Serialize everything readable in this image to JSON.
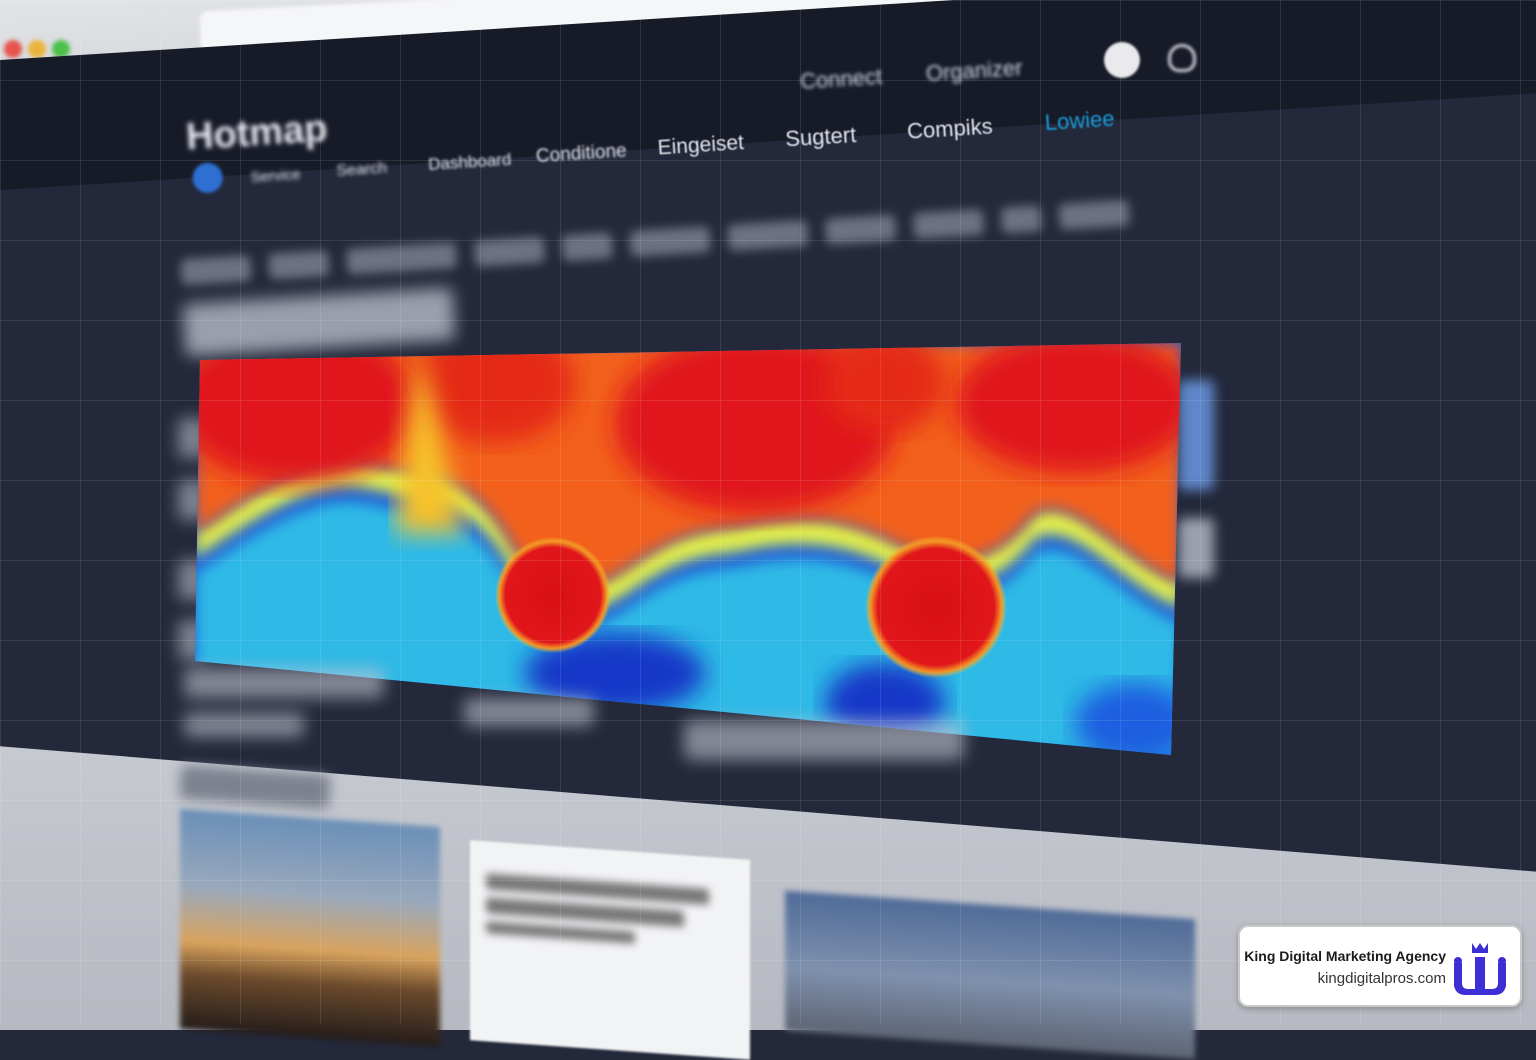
{
  "browser": {
    "tab_title": "",
    "address": ""
  },
  "app": {
    "logo": "Hotmap",
    "header_links": [
      "Connect",
      "Organizer"
    ],
    "nav": [
      {
        "label": "Service"
      },
      {
        "label": "Search"
      },
      {
        "label": "Dashboard"
      },
      {
        "label": "Conditione"
      },
      {
        "label": "Eingeiset"
      },
      {
        "label": "Sugtert"
      },
      {
        "label": "Compiks"
      },
      {
        "label": "Lowiee",
        "active": true
      }
    ]
  },
  "colors": {
    "nav_active": "#1a9bd7",
    "header_bg": "#171b28",
    "page_bg": "#23283a"
  },
  "heatmap": {
    "palette": [
      "#e0131a",
      "#f2611d",
      "#f6c22b",
      "#d7f24a",
      "#2ec3e6",
      "#1a6fe0",
      "#1838c8"
    ],
    "hotspots": 2
  },
  "badge": {
    "name": "King Digital Marketing Agency",
    "url": "kingdigitalpros.com",
    "logo_color": "#3c2fd6"
  }
}
